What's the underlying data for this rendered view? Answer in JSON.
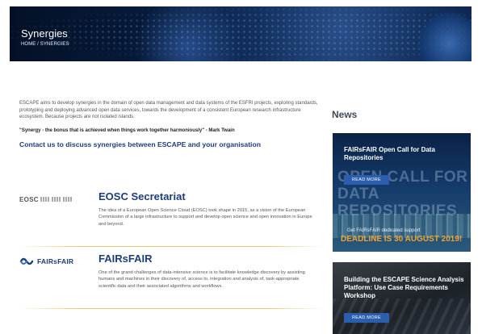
{
  "hero": {
    "title": "Synergies",
    "breadcrumb_home": "HOME",
    "breadcrumb_sep": " / ",
    "breadcrumb_current": "SYNERGIES"
  },
  "intro": {
    "text": "ESCAPE aims to develop synergies in the domain of open data management and data systems of the ESFRI projects, exploring standards, prototyping and deploying advanced open data services, towards the development of a consistent European research infrastructure ecosystem. Because projects are not isolated islands.",
    "quote": "\"Synergy - the bonus that is achieved when things work together harmoniously\" - Mark Twain",
    "contact": "Contact us to discuss synergies between ESCAPE and your organisation"
  },
  "entries": [
    {
      "logo": "EOSC",
      "title": "EOSC Secretariat",
      "text": "The idea of a European Open Science Cloud (EOSC) took shape in 2015, as a vision of the European Commission of a large infrastructure to support and develop open science and open innovation in Europe and beyond."
    },
    {
      "logo": "FAIRsFAIR",
      "title": "FAIRsFAIR",
      "text": "One of the grand challenges of data-intensive science is to facilitate knowledge discovery by assisting humans and machines in their discovery of, access to, integration and analysis of, task-appropriate scientific data and their associated algorithms and workflows."
    }
  ],
  "news": {
    "title": "News",
    "items": [
      {
        "title": "FAIRsFAIR Open Call for Data Repositories",
        "read_more": "READ MORE",
        "image_text": "OPEN CALL FOR DATA REPOSITORIES",
        "image_sub": "Get FAIRsFAIR dedicated support",
        "image_deadline": "DEADLINE IS 30 AUGUST 2019!"
      },
      {
        "title": "Building the ESCAPE Science Analysis Platform: Use Case Requirements Workshop",
        "read_more": "READ MORE"
      }
    ]
  },
  "colors": {
    "accent": "#1d3e78",
    "button": "#2b5fae",
    "deadline": "#f0a431",
    "separator": "#e2c872"
  }
}
